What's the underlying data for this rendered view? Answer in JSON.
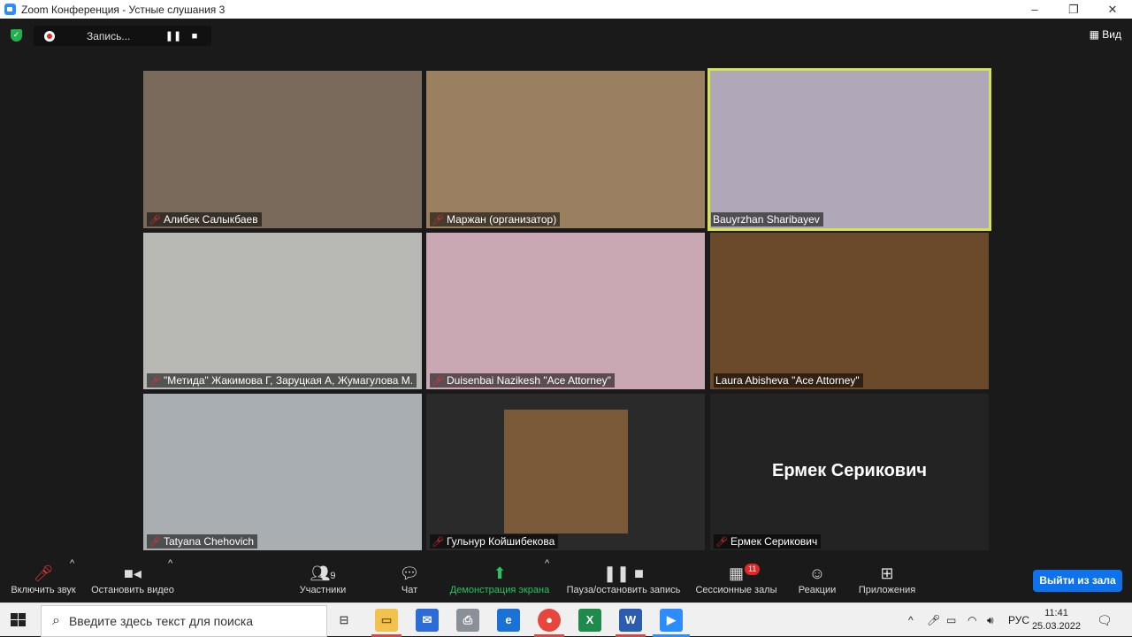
{
  "window": {
    "title": "Zoom Конференция - Устные слушания 3",
    "minimize": "–",
    "restore": "❐",
    "close": "✕"
  },
  "recording": {
    "label": "Запись..."
  },
  "view_button": {
    "label": "Вид"
  },
  "tiles": [
    {
      "name": "Алибек Салыкбаев",
      "muted": true,
      "bg": "#7a6a5c"
    },
    {
      "name": "Маржан (организатор)",
      "muted": true,
      "bg": "#9a8060"
    },
    {
      "name": "Bauyrzhan Sharibayev",
      "muted": false,
      "bg": "#b0a8b8",
      "active": true
    },
    {
      "name": "\"Метида\" Жакимова Г, Заруцкая А, Жумагулова М.",
      "muted": true,
      "bg": "#b8b8b4"
    },
    {
      "name": "Duisenbai Nazikesh \"Ace Attorney\"",
      "muted": true,
      "bg": "#c9a8b4"
    },
    {
      "name": "Laura Abisheva \"Ace Attorney\"",
      "muted": false,
      "bg": "#6a4a2a"
    },
    {
      "name": "Tatyana Chehovich",
      "muted": true,
      "bg": "#a8aeb2"
    },
    {
      "name": "Гульнур Койшибекова",
      "muted": true,
      "bg": "#2a2a2a"
    },
    {
      "name": "Ермек Серикович",
      "muted": true,
      "bg": "#232323",
      "big_name": "Ермек Серикович"
    }
  ],
  "toolbar": {
    "unmute": "Включить звук",
    "stop_video": "Остановить видео",
    "participants": "Участники",
    "participants_count": "9",
    "chat": "Чат",
    "share": "Демонстрация экрана",
    "pause_record": "Пауза/остановить запись",
    "breakout": "Сессионные залы",
    "breakout_count": "11",
    "reactions": "Реакции",
    "apps": "Приложения",
    "leave": "Выйти из зала"
  },
  "taskbar": {
    "search_placeholder": "Введите здесь текст для поиска",
    "lang": "РУС",
    "time": "11:41",
    "date": "25.03.2022"
  },
  "colors": {
    "accent": "#0e72ed",
    "active_speaker": "#d7e34a",
    "share_green": "#22c55e",
    "alert_red": "#e02828"
  }
}
